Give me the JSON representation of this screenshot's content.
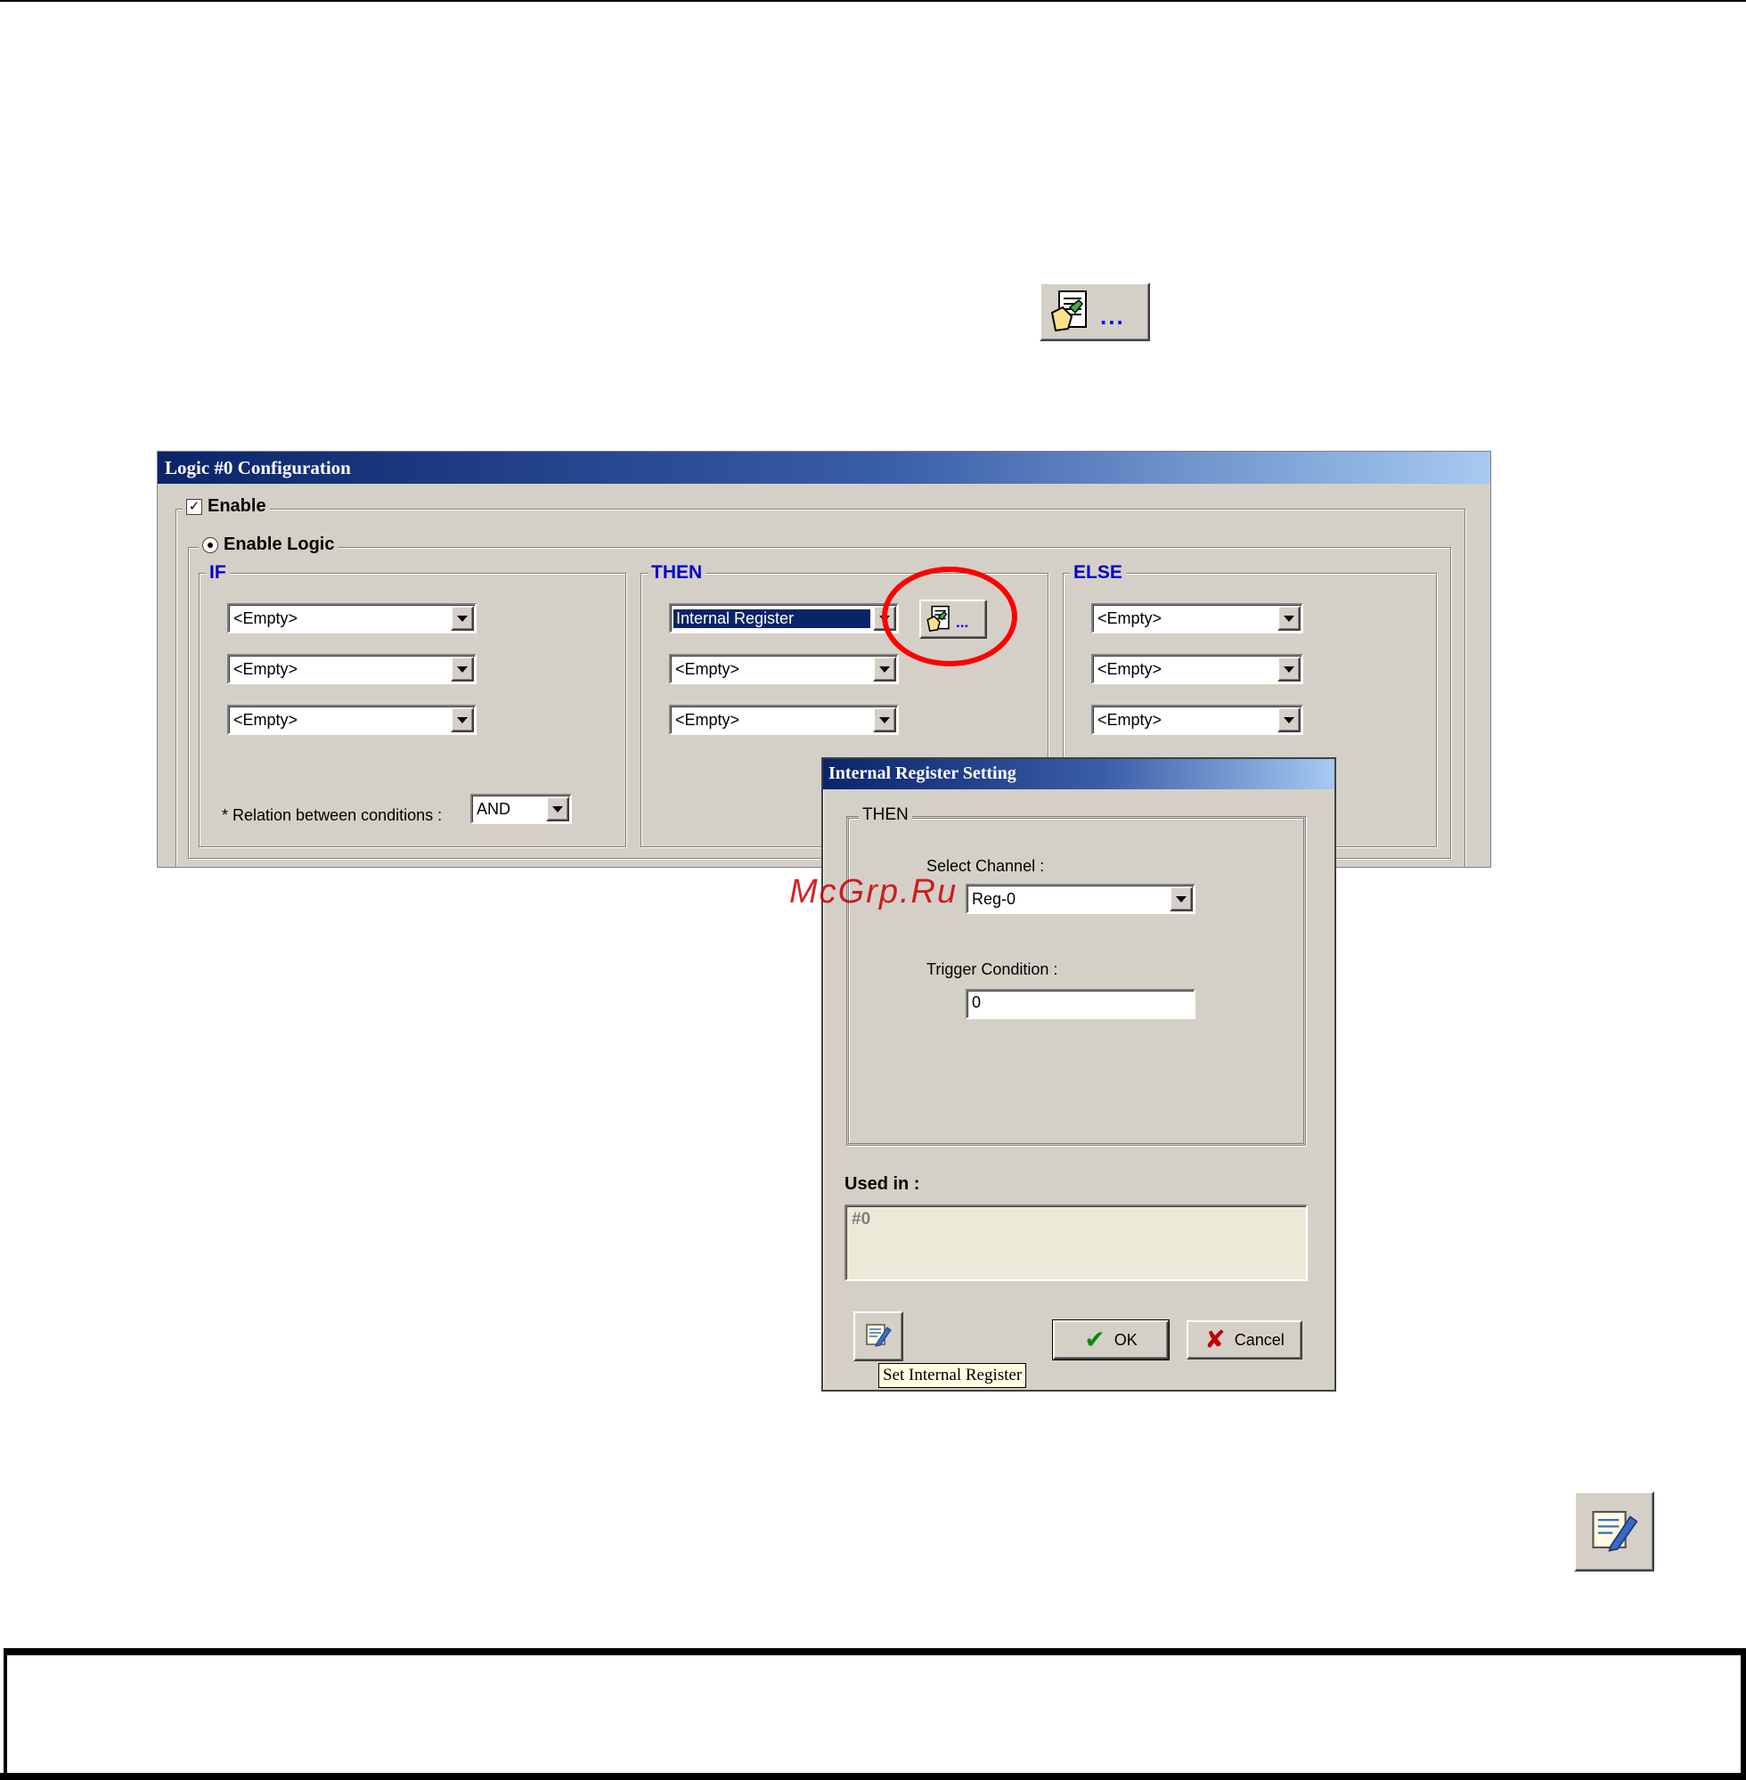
{
  "top_button": {
    "icon": "document-hand-icon",
    "dots": "..."
  },
  "logic_window": {
    "title": "Logic #0 Configuration",
    "enable_label": "Enable",
    "enable_checked": true,
    "enable_logic_label": "Enable Logic",
    "if": {
      "label": "IF",
      "rows": [
        "<Empty>",
        "<Empty>",
        "<Empty>"
      ],
      "relation_label": "* Relation between conditions :",
      "relation_value": "AND"
    },
    "then": {
      "label": "THEN",
      "rows": [
        "Internal Register",
        "<Empty>",
        "<Empty>"
      ],
      "config_button_dots": "..."
    },
    "else": {
      "label": "ELSE",
      "rows": [
        "<Empty>",
        "<Empty>",
        "<Empty>"
      ]
    }
  },
  "register_dialog": {
    "title": "Internal Register Setting",
    "group_label": "THEN",
    "select_channel_label": "Select Channel :",
    "select_channel_value": "Reg-0",
    "trigger_condition_label": "Trigger Condition :",
    "trigger_condition_value": "0",
    "used_in_label": "Used in :",
    "used_in_value": "#0",
    "ok_label": "OK",
    "cancel_label": "Cancel",
    "tooltip": "Set Internal Register"
  },
  "watermark": "McGrp.Ru",
  "bottom_icon": "edit-notepad-icon"
}
